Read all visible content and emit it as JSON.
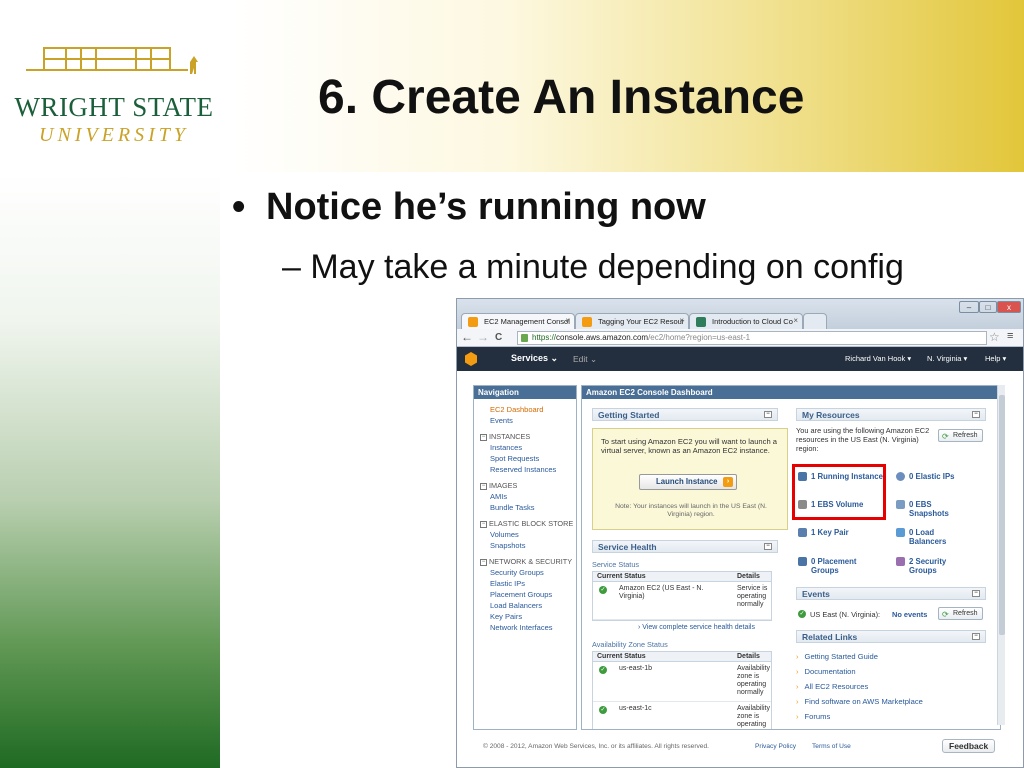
{
  "slide": {
    "title": "6. Create An Instance",
    "bullet": "Notice he’s running now",
    "sub_bullet": "– May take a minute depending on config",
    "bullet_glyph": "•"
  },
  "logo": {
    "name": "WRIGHT STATE",
    "sub": "UNIVERSITY",
    "colors": {
      "green": "#1b5e3a",
      "gold": "#c9a227"
    }
  },
  "browser": {
    "tabs": [
      {
        "label": "EC2 Management Consol",
        "favicon": "aws-favicon",
        "color": "#f39c12"
      },
      {
        "label": "Tagging Your EC2 Resour",
        "favicon": "aws-favicon",
        "color": "#f39c12"
      },
      {
        "label": "Introduction to Cloud Co",
        "favicon": "w-favicon",
        "color": "#2e7d5b"
      }
    ],
    "close_glyph": "×",
    "window_controls": [
      "–",
      "□",
      "x"
    ],
    "url_scheme": "https://",
    "url_host": "console.aws.amazon.com",
    "url_path": "/ec2/home?region=us-east-1",
    "back_glyph": "←",
    "forward_glyph": "→",
    "reload_glyph": "C",
    "star_glyph": "☆",
    "menu_glyph": "≡"
  },
  "awsbar": {
    "services": "Services ⌄",
    "edit": "Edit ⌄",
    "user": "Richard Van Hook ▾",
    "region": "N. Virginia ▾",
    "help": "Help ▾"
  },
  "navigation": {
    "title": "Navigation",
    "current": "EC2 Dashboard",
    "events": "Events",
    "sections": [
      {
        "label": "INSTANCES",
        "items": [
          "Instances",
          "Spot Requests",
          "Reserved Instances"
        ]
      },
      {
        "label": "IMAGES",
        "items": [
          "AMIs",
          "Bundle Tasks"
        ]
      },
      {
        "label": "ELASTIC BLOCK STORE",
        "items": [
          "Volumes",
          "Snapshots"
        ]
      },
      {
        "label": "NETWORK & SECURITY",
        "items": [
          "Security Groups",
          "Elastic IPs",
          "Placement Groups",
          "Load Balancers",
          "Key Pairs",
          "Network Interfaces"
        ]
      }
    ],
    "collapse_glyph": "−"
  },
  "dashboard": {
    "title": "Amazon EC2 Console Dashboard",
    "getting_started": {
      "title": "Getting Started",
      "text": "To start using Amazon EC2 you will want to launch a virtual server, known as an Amazon EC2 instance.",
      "button": "Launch Instance",
      "note": "Note: Your instances will launch in the US East (N. Virginia) region."
    },
    "service_health": {
      "title": "Service Health",
      "service_status_label": "Service Status",
      "col_status": "Current Status",
      "col_details": "Details",
      "service_rows": [
        {
          "name": "Amazon EC2 (US East - N. Virginia)",
          "details": "Service is operating normally"
        }
      ],
      "view_link": "View complete service health details",
      "az_label": "Availability Zone Status",
      "az_rows": [
        {
          "name": "us-east-1b",
          "details": "Availability zone is operating normally"
        },
        {
          "name": "us-east-1c",
          "details": "Availability zone is operating"
        }
      ]
    },
    "my_resources": {
      "title": "My Resources",
      "intro": "You are using the following Amazon EC2 resources in the US East (N. Virginia) region:",
      "refresh": "Refresh",
      "items": [
        {
          "label": "1 Running Instance",
          "icon": "server-icon",
          "color": "#4a74a5"
        },
        {
          "label": "0 Elastic IPs",
          "icon": "ip-icon",
          "color": "#6c8ebf"
        },
        {
          "label": "1 EBS Volume",
          "icon": "volume-icon",
          "color": "#8a8a8a"
        },
        {
          "label": "0 EBS Snapshots",
          "icon": "snapshot-icon",
          "color": "#7a9cc2"
        },
        {
          "label": "1 Key Pair",
          "icon": "key-icon",
          "color": "#5a7fae"
        },
        {
          "label": "0 Load Balancers",
          "icon": "balancer-icon",
          "color": "#5b9bd5"
        },
        {
          "label": "0 Placement Groups",
          "icon": "placement-icon",
          "color": "#4a74a5"
        },
        {
          "label": "2 Security Groups",
          "icon": "shield-icon",
          "color": "#9a6fb0"
        }
      ]
    },
    "events": {
      "title": "Events",
      "region": "US East (N. Virginia):",
      "value": "No events",
      "refresh": "Refresh"
    },
    "related_links": {
      "title": "Related Links",
      "items": [
        "Getting Started Guide",
        "Documentation",
        "All EC2 Resources",
        "Find software on AWS Marketplace",
        "Forums"
      ],
      "glyph": "›"
    }
  },
  "footer": {
    "copyright": "© 2008 - 2012, Amazon Web Services, Inc. or its affiliates. All rights reserved.",
    "privacy": "Privacy Policy",
    "terms": "Terms of Use",
    "feedback": "Feedback"
  },
  "colors": {
    "highlight": "#e60000",
    "aws_orange": "#f39c12",
    "aws_dark": "#232f3e"
  }
}
